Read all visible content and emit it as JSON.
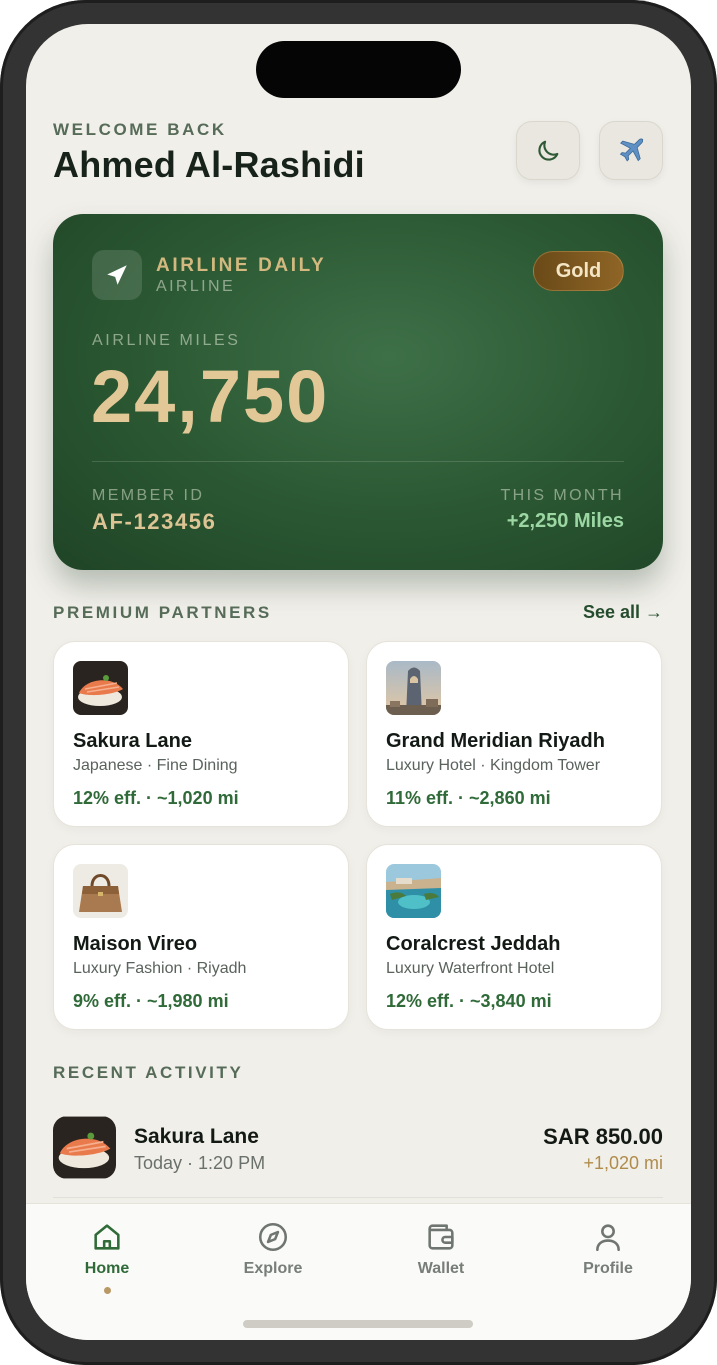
{
  "header": {
    "greeting": "WELCOME BACK",
    "user_name": "Ahmed Al-Rashidi",
    "theme_icon": "moon-icon",
    "flight_icon": "airplane-icon"
  },
  "card": {
    "brand": "AIRLINE DAILY",
    "brand_sub": "AIRLINE",
    "tier": "Gold",
    "miles_label": "AIRLINE MILES",
    "miles_value": "24,750",
    "member_label": "MEMBER ID",
    "member_id": "AF-123456",
    "month_label": "THIS MONTH",
    "month_value": "+2,250 Miles",
    "colors": {
      "card_green": "#2c5a34",
      "gold": "#e3c897",
      "accent_green": "#9bd6a3"
    }
  },
  "partners": {
    "title": "PREMIUM PARTNERS",
    "see_all": "See all →",
    "items": [
      {
        "name": "Sakura Lane",
        "subtitle": "Japanese · Fine Dining",
        "stat": "12% eff. · ~1,020 mi",
        "image": "sushi-image"
      },
      {
        "name": "Grand Meridian Riyadh",
        "subtitle": "Luxury Hotel · Kingdom Tower",
        "stat": "11% eff. · ~2,860 mi",
        "image": "tower-image"
      },
      {
        "name": "Maison Vireo",
        "subtitle": "Luxury Fashion · Riyadh",
        "stat": "9% eff. · ~1,980 mi",
        "image": "handbag-image"
      },
      {
        "name": "Coralcrest Jeddah",
        "subtitle": "Luxury Waterfront Hotel",
        "stat": "12% eff. · ~3,840 mi",
        "image": "resort-image"
      }
    ]
  },
  "activity": {
    "title": "RECENT ACTIVITY",
    "items": [
      {
        "name": "Sakura Lane",
        "time": "Today · 1:20 PM",
        "amount": "SAR 850.00",
        "miles": "+1,020 mi",
        "image": "sushi-image"
      }
    ]
  },
  "tabbar": {
    "tabs": [
      {
        "label": "Home",
        "icon": "home-icon",
        "active": true
      },
      {
        "label": "Explore",
        "icon": "compass-icon",
        "active": false
      },
      {
        "label": "Wallet",
        "icon": "wallet-icon",
        "active": false
      },
      {
        "label": "Profile",
        "icon": "person-icon",
        "active": false
      }
    ]
  }
}
